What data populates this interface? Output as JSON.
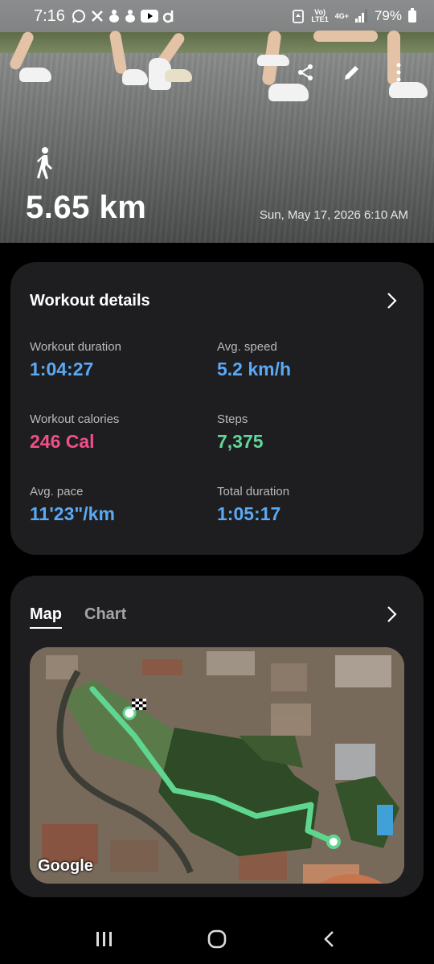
{
  "status_bar": {
    "time": "7:16",
    "network_top": "Vo)",
    "network_bottom": "LTE1",
    "network_type": "4G+",
    "battery": "79%"
  },
  "hero": {
    "distance": "5.65 km",
    "date": "Sun, May 17, 2026 6:10 AM",
    "activity_icon": "walk-icon"
  },
  "details": {
    "title": "Workout details",
    "metrics": [
      {
        "label": "Workout duration",
        "value": "1:04:27",
        "color": "#5aa9f5"
      },
      {
        "label": "Avg. speed",
        "value": "5.2 km/h",
        "color": "#5aa9f5"
      },
      {
        "label": "Workout calories",
        "value": "246 Cal",
        "color": "#f24e8a"
      },
      {
        "label": "Steps",
        "value": "7,375",
        "color": "#63d69a"
      },
      {
        "label": "Avg. pace",
        "value": "11'23\"/km",
        "color": "#5aa9f5"
      },
      {
        "label": "Total duration",
        "value": "1:05:17",
        "color": "#5aa9f5"
      }
    ]
  },
  "map_card": {
    "tabs": [
      {
        "label": "Map",
        "active": true
      },
      {
        "label": "Chart",
        "active": false
      }
    ],
    "map_attribution": "Google",
    "route_color": "#5fd690"
  }
}
